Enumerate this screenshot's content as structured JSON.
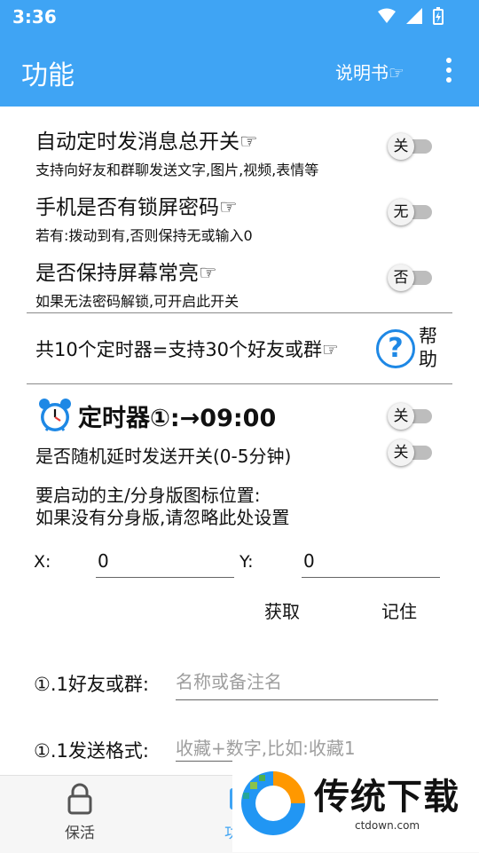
{
  "status": {
    "time": "3:36"
  },
  "appbar": {
    "title": "功能",
    "manual_label": "说明书☞"
  },
  "settings": [
    {
      "label": "自动定时发消息总开关☞",
      "sub": "支持向好友和群聊发送文字,图片,视频,表情等",
      "toggle": "关"
    },
    {
      "label": "手机是否有锁屏密码☞",
      "sub": "若有:拨动到有,否则保持无或输入0",
      "toggle": "无"
    },
    {
      "label": "是否保持屏幕常亮☞",
      "sub": "如果无法密码解锁,可开启此开关",
      "toggle": "否"
    }
  ],
  "timers_info": "共10个定时器=支持30个好友或群☞",
  "help_label": "帮助",
  "timer": {
    "title": "定时器①:→09:00",
    "toggle": "关",
    "random_label": "是否随机延时发送开关(0-5分钟)",
    "random_toggle": "关",
    "hint_line1": "要启动的主/分身版图标位置:",
    "hint_line2": "如果没有分身版,请忽略此处设置",
    "x_label": "X:",
    "x_value": "0",
    "y_label": "Y:",
    "y_value": "0",
    "get_label": "获取",
    "remember_label": "记住",
    "friend_label": "①.1好友或群:",
    "friend_placeholder": "名称或备注名",
    "format_label": "①.1发送格式:",
    "format_placeholder": "收藏+数字,比如:收藏1"
  },
  "bottomnav": [
    {
      "label": "保活",
      "icon": "lock-icon"
    },
    {
      "label": "功能",
      "icon": "function-icon"
    }
  ],
  "watermark": {
    "text": "传统下载",
    "url": "ctdown.com"
  },
  "colors": {
    "primary": "#3fa4f4",
    "help_blue": "#1e88e5"
  }
}
